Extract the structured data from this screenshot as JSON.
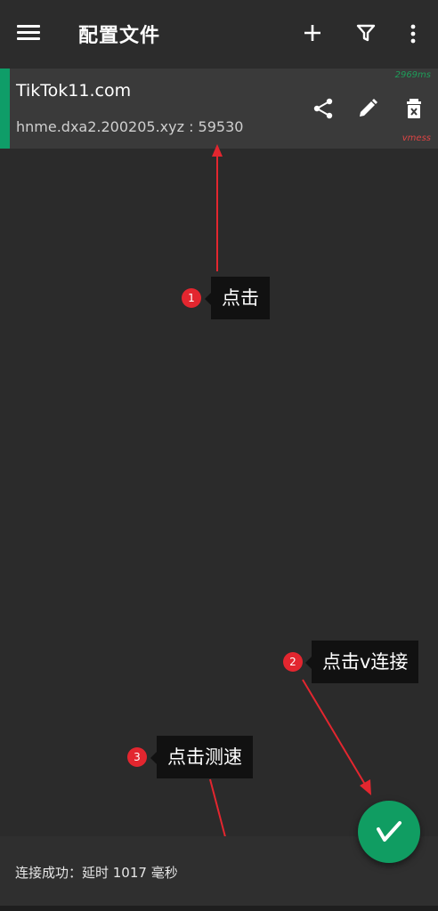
{
  "app": {
    "title": "配置文件"
  },
  "toolbar": {
    "menu_icon": "hamburger-menu-icon",
    "add_icon": "plus-icon",
    "filter_icon": "filter-icon",
    "more_icon": "more-vert-icon"
  },
  "server": {
    "name": "TikTok11.com",
    "address": "hnme.dxa2.200205.xyz : 59530",
    "latency": "2969ms",
    "protocol": "vmess",
    "accent_color": "#0f9d68"
  },
  "annotations": [
    {
      "number": "1",
      "text": "点击"
    },
    {
      "number": "2",
      "text": "点击v连接"
    },
    {
      "number": "3",
      "text": "点击测速"
    }
  ],
  "fab": {
    "label": "V"
  },
  "status": {
    "text": "连接成功：延时 1017 毫秒"
  },
  "colors": {
    "accent": "#109d62",
    "arrow": "#e3262f",
    "latency": "#1e9e5a",
    "protocol": "#d44444"
  }
}
